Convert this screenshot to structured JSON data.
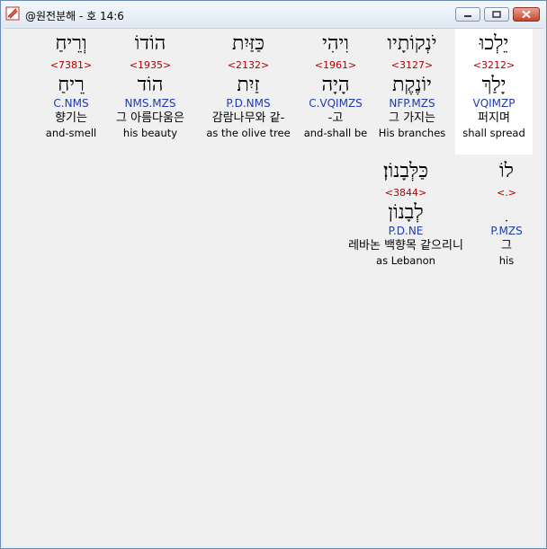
{
  "window": {
    "title": "@원전분해 - 호 14:6",
    "icon": "app-icon"
  },
  "row1": [
    {
      "hebrew": "יֵלְכוּ",
      "strong": "<3212>",
      "lemma": "יָלַךְ",
      "parse": "VQIMZP",
      "korean": "퍼지며",
      "english": "shall spread"
    },
    {
      "hebrew": "יֹנְקוֹתָיו",
      "strong": "<3127>",
      "lemma": "יוֹנֶקֶת",
      "parse": "NFP.MZS",
      "korean": "그 가지는",
      "english": "His branches"
    },
    {
      "hebrew": "וִיהִי",
      "strong": "<1961>",
      "lemma": "הָיָה",
      "parse": "C.VQIMZS",
      "korean": "-고",
      "english": "and-shall be"
    },
    {
      "hebrew": "כַּזַּיִת",
      "strong": "<2132>",
      "lemma": "זַיִת",
      "parse": "P.D.NMS",
      "korean": "감람나무와 같-",
      "english": "as the olive tree"
    },
    {
      "hebrew": "הוֹדוֹ",
      "strong": "<1935>",
      "lemma": "הוֹד",
      "parse": "NMS.MZS",
      "korean": "그 아름다움은",
      "english": "his beauty"
    },
    {
      "hebrew": "וְרֵיחַ",
      "strong": "<7381>",
      "lemma": "רֵיחַ",
      "parse": "C.NMS",
      "korean": "향기는",
      "english": "and-smell"
    }
  ],
  "row2": [
    {
      "hebrew": "לוֹ",
      "strong": "<.>",
      "lemma": "ִ",
      "parse": "P.MZS",
      "korean": "그",
      "english": "his"
    },
    {
      "hebrew": "כַּלְּבָנוֹן׃",
      "strong": "<3844>",
      "lemma": "לְבָנוֹן",
      "parse": "P.D.NE",
      "korean": "레바논 백향목 같으리니",
      "english": "as Lebanon"
    }
  ]
}
